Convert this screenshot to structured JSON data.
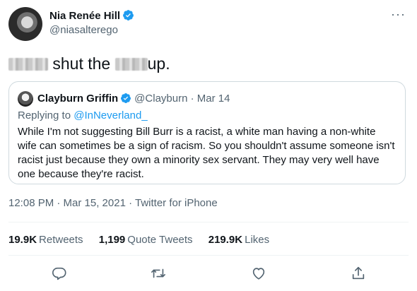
{
  "author": {
    "name": "Nia Renée Hill",
    "handle": "@niasalterego"
  },
  "tweet": {
    "text_part1": "shut the",
    "text_part2": "up."
  },
  "quote": {
    "name": "Clayburn Griffin",
    "meta": "@Clayburn · Mar 14",
    "reply_prefix": "Replying to",
    "reply_to": "@InNeverland_",
    "text": "While I'm not suggesting Bill Burr is a racist, a white man having a non-white wife can sometimes be a sign of racism.  So you shouldn't assume someone isn't racist just because they own a minority sex servant.   They may very well have one because they're racist."
  },
  "timestamp": "12:08 PM · Mar 15, 2021 · Twitter for iPhone",
  "stats": {
    "retweets_count": "19.9K",
    "retweets_label": "Retweets",
    "quotes_count": "1,199",
    "quotes_label": "Quote Tweets",
    "likes_count": "219.9K",
    "likes_label": "Likes"
  },
  "icons": {
    "verified": "verified-badge-icon",
    "more": "more-options-icon",
    "reply": "reply-icon",
    "retweet": "retweet-icon",
    "like": "heart-icon",
    "share": "share-icon"
  },
  "colors": {
    "accent": "#1d9bf0",
    "text": "#0f1419",
    "muted": "#536471",
    "border": "#cfd9de"
  }
}
